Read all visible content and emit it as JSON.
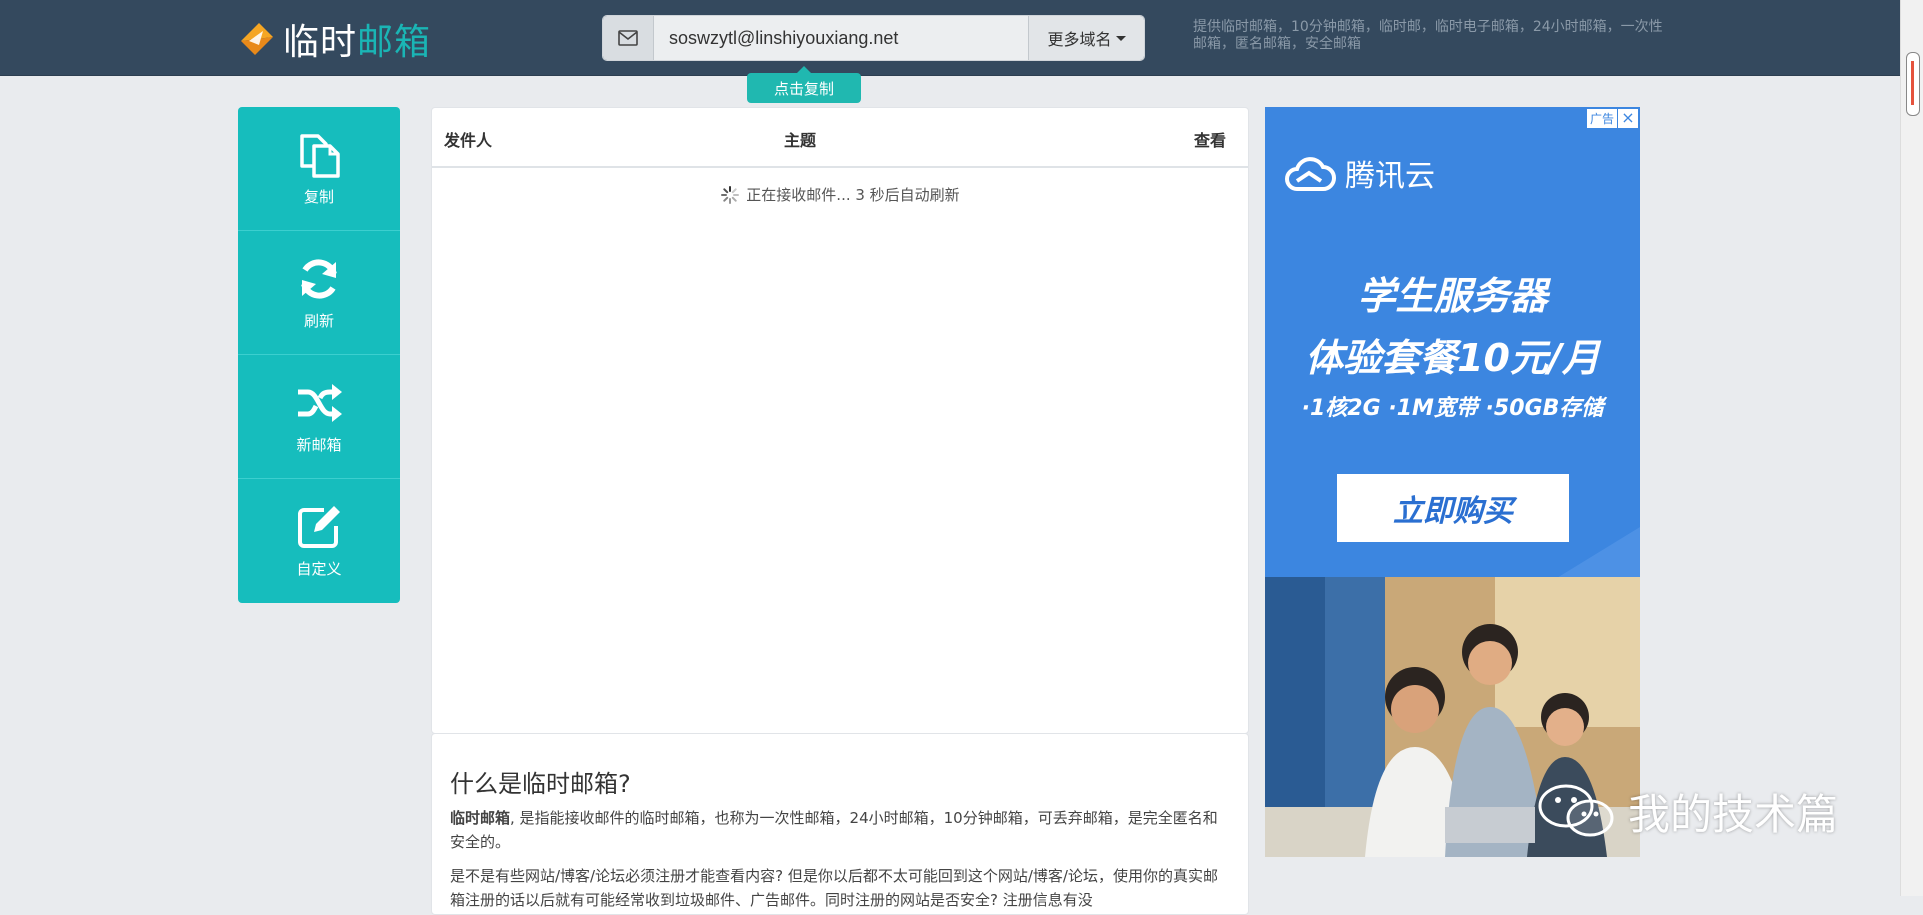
{
  "brand": {
    "name_part1": "临时",
    "name_part2": "邮箱",
    "accent": "#1ab5b5",
    "logo_color": "#f5a623"
  },
  "header": {
    "email_value": "soswzytl@linshiyouxiang.net",
    "domain_button": "更多域名",
    "copy_tip": "点击复制",
    "description": "提供临时邮箱，10分钟邮箱，临时邮，临时电子邮箱，24小时邮箱，一次性邮箱，匿名邮箱，安全邮箱"
  },
  "sidebar": {
    "items": [
      {
        "label": "复制",
        "icon": "copy-icon"
      },
      {
        "label": "刷新",
        "icon": "refresh-icon"
      },
      {
        "label": "新邮箱",
        "icon": "shuffle-icon"
      },
      {
        "label": "自定义",
        "icon": "edit-icon"
      }
    ]
  },
  "inbox": {
    "columns": {
      "sender": "发件人",
      "subject": "主题",
      "view": "查看"
    },
    "status": "正在接收邮件... 3 秒后自动刷新"
  },
  "info": {
    "title": "什么是临时邮箱?",
    "p1_bold": "临时邮箱",
    "p1_rest": ", 是指能接收邮件的临时邮箱，也称为一次性邮箱，24小时邮箱，10分钟邮箱，可丢弃邮箱，是完全匿名和安全的。",
    "p2": "是不是有些网站/博客/论坛必须注册才能查看内容? 但是你以后都不太可能回到这个网站/博客/论坛，使用你的真实邮箱注册的话以后就有可能经常收到垃圾邮件、广告邮件。同时注册的网站是否安全? 注册信息有没"
  },
  "ad": {
    "tag": "广告",
    "close": "×",
    "brand": "腾讯云",
    "headline1": "学生服务器",
    "headline2": "体验套餐10元/月",
    "features": "·1核2G ·1M宽带 ·50GB存储",
    "cta": "立即购买"
  },
  "watermark": "我的技术篇"
}
